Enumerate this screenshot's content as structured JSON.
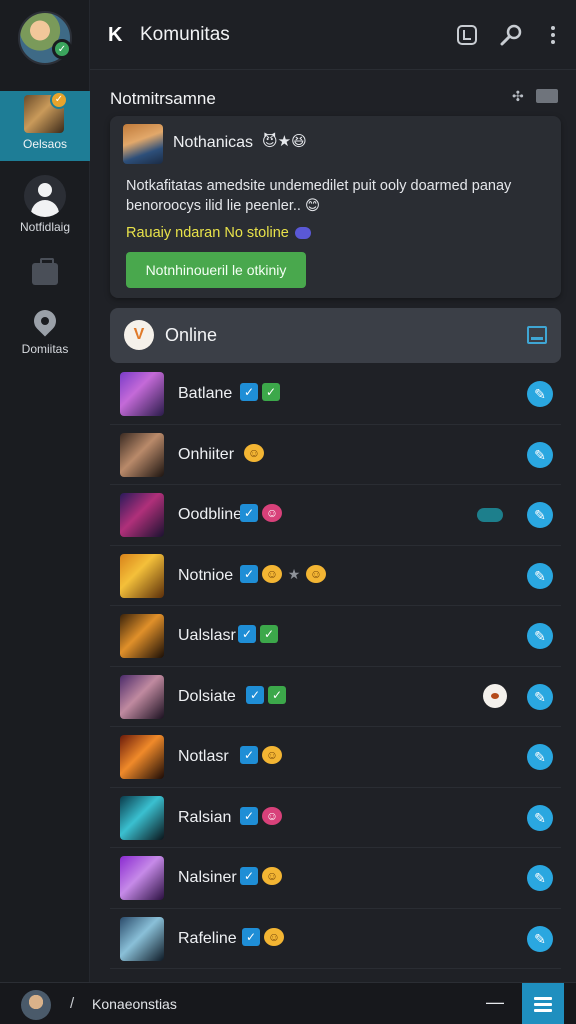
{
  "header": {
    "logo": "K",
    "title": "Komunitas"
  },
  "sidebar": {
    "items": [
      {
        "label": "Oelsaos"
      },
      {
        "label": "Notfidlaig"
      },
      {
        "label": ""
      },
      {
        "label": "Domiitas"
      }
    ]
  },
  "main": {
    "section_title": "Notmitrsamne",
    "notice": {
      "name": "Nothanicas",
      "emojis": "😈★😆",
      "text": "Notkafitatas amedsite undemedilet puit ooly doarmed panay benoroocys ilid lie peenler..",
      "text_emoji": "😊",
      "highlight": "Rauaiy ndaran No stoline",
      "button": "Notnhinoueril le otkiniy"
    },
    "online": {
      "badge": "V",
      "label": "Online"
    },
    "members": [
      {
        "name": "Batlane"
      },
      {
        "name": "Onhiiter"
      },
      {
        "name": "Oodbline"
      },
      {
        "name": "Notnioe"
      },
      {
        "name": "Ualslasr"
      },
      {
        "name": "Dolsiate"
      },
      {
        "name": "Notlasr"
      },
      {
        "name": "Ralsian"
      },
      {
        "name": "Nalsiner"
      },
      {
        "name": "Rafeline"
      }
    ]
  },
  "footer": {
    "slash": "/",
    "title": "Konaeonstias"
  },
  "colors": {
    "accent": "#1e7d96",
    "button_green": "#49a84d",
    "action_blue": "#2aa7e0",
    "highlight_yellow": "#e8e24a"
  }
}
